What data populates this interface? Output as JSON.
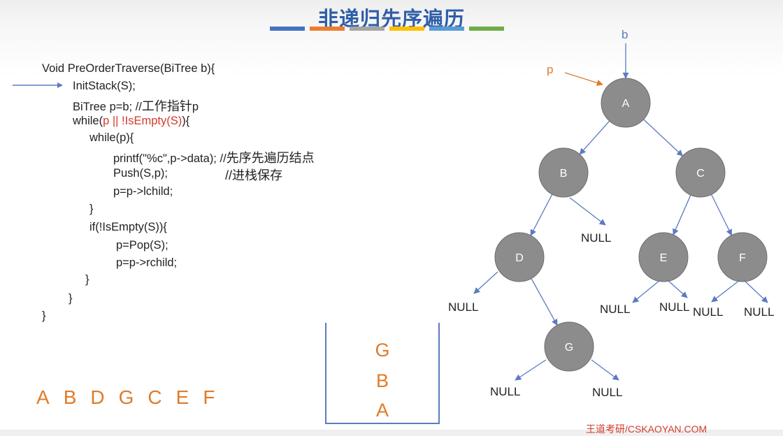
{
  "title": "非递归先序遍历",
  "title_bar_colors": [
    "#4472c4",
    "#ed7d31",
    "#a5a5a5",
    "#ffc000",
    "#5b9bd5",
    "#70ad47"
  ],
  "code": {
    "l1": "Void PreOrderTraverse(BiTree b){",
    "l2": "InitStack(S);",
    "l3a": "BiTree p=b;  //",
    "l3b": "工作指针",
    "l3c": "p",
    "l4a": "while(",
    "l4b": "p ||  !IsEmpty(S)",
    "l4c": "){",
    "l5": "while(p){",
    "l6a": "printf(\"%c\",p->data); //",
    "l6b": "先序先遍历结点",
    "l7a": "Push(S,p);",
    "l7b": "//进栈保存",
    "l8": "p=p->lchild;",
    "l9": "}",
    "l10": "if(!IsEmpty(S)){",
    "l11": "p=Pop(S);",
    "l12": "p=p->rchild;",
    "l13": "}",
    "l14": "}",
    "l15": "}"
  },
  "traversal_sequence": [
    "A",
    "B",
    "D",
    "G",
    "C",
    "E",
    "F"
  ],
  "stack_items": [
    "G",
    "B",
    "A"
  ],
  "tree": {
    "pointer_b": "b",
    "pointer_p": "p",
    "nodes": [
      "A",
      "B",
      "C",
      "D",
      "E",
      "F",
      "G"
    ],
    "null_label": "NULL"
  },
  "footer": "王道考研/CSKAOYAN.COM",
  "colors": {
    "accent": "#2f5ea8",
    "highlight": "#d23b2a",
    "orange": "#e07b28",
    "node_fill": "#8c8c8c",
    "edge": "#5b7bc0"
  }
}
